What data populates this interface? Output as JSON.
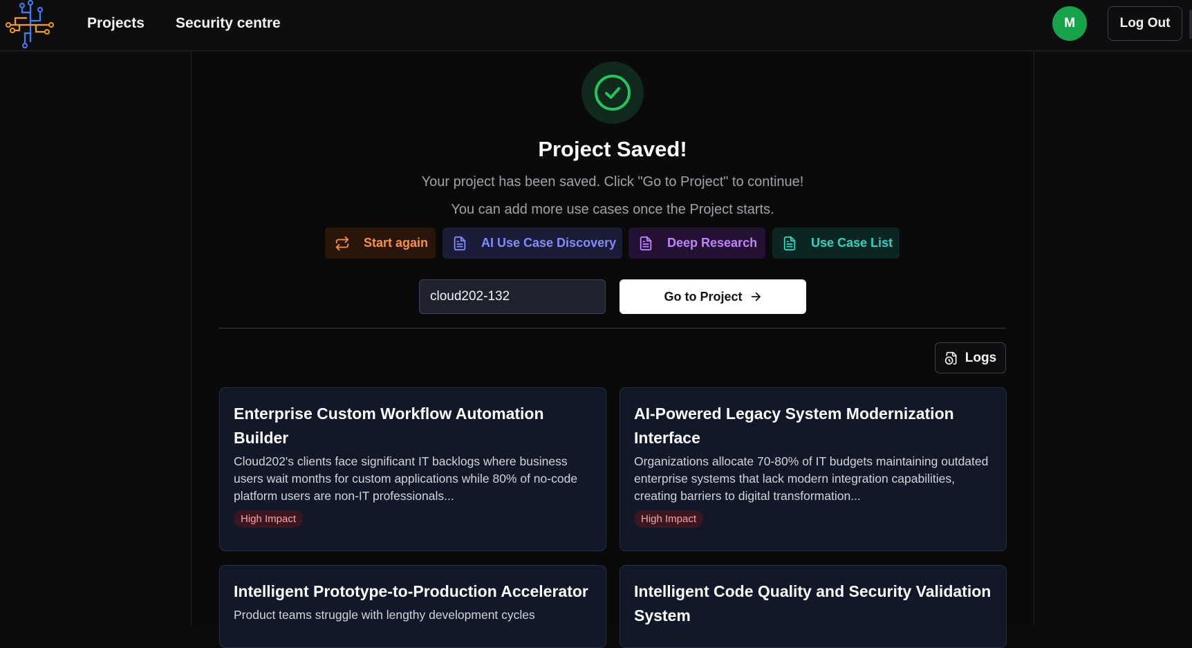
{
  "nav": {
    "projects_label": "Projects",
    "security_label": "Security centre",
    "avatar_initial": "M",
    "logout_label": "Log Out"
  },
  "status": {
    "title": "Project Saved!",
    "message": "Your project has been saved. Click \"Go to Project\" to continue!",
    "note": "You can add more use cases once the Project starts."
  },
  "actions": [
    {
      "label": "Start again",
      "icon": "repeat-icon",
      "color": "#fb923c"
    },
    {
      "label": "AI Use Case Discovery",
      "icon": "document-icon",
      "color": "#818cf8"
    },
    {
      "label": "Deep Research",
      "icon": "document-icon",
      "color": "#c084fc"
    },
    {
      "label": "Use Case List",
      "icon": "document-icon",
      "color": "#2dd4bf"
    }
  ],
  "project": {
    "name_value": "cloud202-132",
    "go_label": "Go to Project"
  },
  "logs_label": "Logs",
  "use_cases": [
    {
      "title": "Enterprise Custom Workflow Automation Builder",
      "description": "Cloud202's clients face significant IT backlogs where business users wait months for custom applications while 80% of no-code platform users are non-IT professionals...",
      "badge": "High Impact"
    },
    {
      "title": "AI-Powered Legacy System Modernization Interface",
      "description": "Organizations allocate 70-80% of IT budgets maintaining outdated enterprise systems that lack modern integration capabilities, creating barriers to digital transformation...",
      "badge": "High Impact"
    },
    {
      "title": "Intelligent Prototype-to-Production Accelerator",
      "description": "Product teams struggle with lengthy development cycles"
    },
    {
      "title": "Intelligent Code Quality and Security Validation System",
      "description": ""
    }
  ],
  "colors": {
    "success": "#22c55e",
    "avatar": "#16a34a",
    "badge_text": "#fca5a5"
  }
}
